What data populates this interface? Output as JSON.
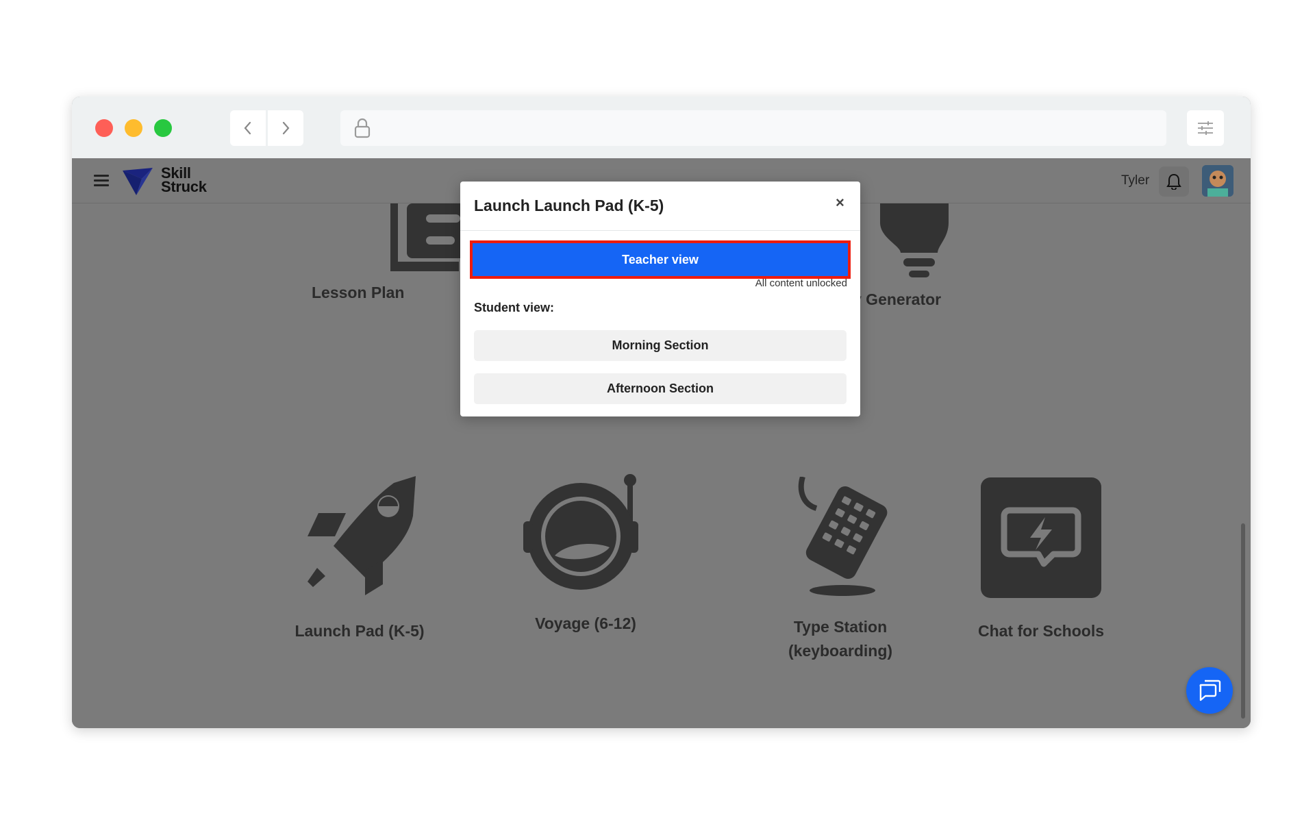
{
  "browser": {
    "back_icon": "chevron-left-icon",
    "forward_icon": "chevron-right-icon",
    "lock_icon": "lock-icon",
    "settings_icon": "sliders-icon"
  },
  "header": {
    "brand_line1": "Skill",
    "brand_line2": "Struck",
    "username": "Tyler"
  },
  "tiles": {
    "lesson_plan": "Lesson Plan",
    "generator": "y Generator",
    "launch_pad": "Launch Pad (K-5)",
    "voyage": "Voyage (6-12)",
    "type_station_line1": "Type Station",
    "type_station_line2": "(keyboarding)",
    "chat": "Chat for Schools"
  },
  "modal": {
    "title": "Launch Launch Pad (K-5)",
    "close": "×",
    "teacher_view": "Teacher view",
    "unlocked_note": "All content unlocked",
    "student_view_label": "Student view:",
    "sections": [
      "Morning Section",
      "Afternoon Section"
    ]
  },
  "colors": {
    "primary": "#1565f5",
    "highlight": "#ee1c0e",
    "overlay": "#7b7b7b"
  }
}
